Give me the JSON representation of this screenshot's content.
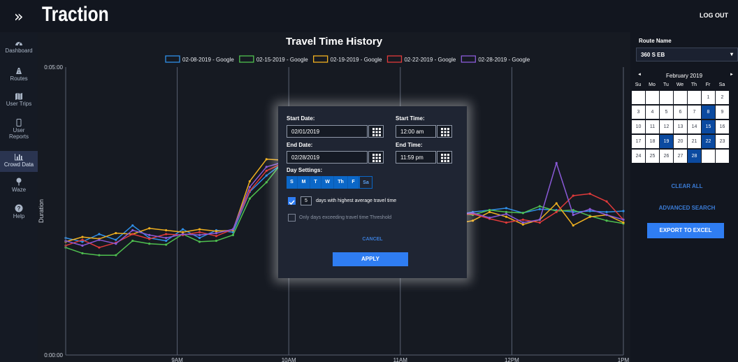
{
  "header": {
    "title": "Traction",
    "logo_icon": "double-chevron-right",
    "logout_label": "LOG OUT"
  },
  "sidebar": {
    "items": [
      {
        "label": "Dashboard",
        "icon": "dashboard-icon",
        "active": false
      },
      {
        "label": "Routes",
        "icon": "routes-icon",
        "active": false
      },
      {
        "label": "User Trips",
        "icon": "map-icon",
        "active": false
      },
      {
        "label": "User",
        "label2": "Reports",
        "icon": "phone-icon",
        "active": false
      },
      {
        "label": "Crowd Data",
        "icon": "bar-chart-icon",
        "active": true
      },
      {
        "label": "Waze",
        "icon": "pin-icon",
        "active": false
      },
      {
        "label": "Help",
        "icon": "help-icon",
        "active": false
      }
    ]
  },
  "chart_data": {
    "type": "line",
    "title": "Travel Time History",
    "xlabel": "",
    "ylabel": "Duration",
    "y_ticks": [
      "0:05:00",
      "0:00:00"
    ],
    "x_ticks": [
      "9AM",
      "10AM",
      "11AM",
      "12PM",
      "1PM"
    ],
    "x_range": [
      8.0,
      13.0
    ],
    "ylim": [
      0,
      300
    ],
    "grid": true,
    "legend_position": "top",
    "series": [
      {
        "name": "02-08-2019 - Google",
        "color": "#2f8fe8",
        "x": [
          8.0,
          8.15,
          8.3,
          8.45,
          8.6,
          8.75,
          8.9,
          9.05,
          9.2,
          9.35,
          9.5,
          9.65,
          9.8,
          9.95,
          10.6,
          10.75,
          10.9,
          11.05,
          11.2,
          11.35,
          11.5,
          11.65,
          11.8,
          11.95,
          12.1,
          12.25,
          12.4,
          12.55,
          12.7,
          12.85,
          13.0
        ],
        "y": [
          122,
          118,
          126,
          120,
          135,
          122,
          119,
          131,
          122,
          130,
          128,
          170,
          187,
          200,
          145,
          139,
          147,
          140,
          142,
          140,
          146,
          149,
          151,
          153,
          148,
          152,
          151,
          149,
          150,
          149,
          150
        ]
      },
      {
        "name": "02-15-2019 - Google",
        "color": "#4fc04f",
        "x": [
          8.0,
          8.15,
          8.3,
          8.45,
          8.6,
          8.75,
          8.9,
          9.05,
          9.2,
          9.35,
          9.5,
          9.65,
          9.8,
          9.95,
          10.6,
          10.75,
          10.9,
          11.05,
          11.2,
          11.35,
          11.5,
          11.65,
          11.8,
          11.95,
          12.1,
          12.25,
          12.4,
          12.55,
          12.7,
          12.85,
          13.0
        ],
        "y": [
          112,
          106,
          104,
          104,
          119,
          116,
          115,
          126,
          118,
          119,
          125,
          163,
          180,
          202,
          149,
          143,
          148,
          140,
          147,
          144,
          148,
          146,
          151,
          149,
          148,
          155,
          150,
          151,
          145,
          140,
          137
        ]
      },
      {
        "name": "02-19-2019 - Google",
        "color": "#f0b020",
        "x": [
          8.0,
          8.15,
          8.3,
          8.45,
          8.6,
          8.75,
          8.9,
          9.05,
          9.2,
          9.35,
          9.5,
          9.65,
          9.8,
          9.95,
          10.6,
          10.75,
          10.9,
          11.05,
          11.2,
          11.35,
          11.5,
          11.65,
          11.8,
          11.95,
          12.1,
          12.25,
          12.4,
          12.55,
          12.7,
          12.85,
          13.0
        ],
        "y": [
          118,
          123,
          121,
          127,
          126,
          132,
          130,
          128,
          131,
          129,
          130,
          181,
          204,
          203,
          149,
          146,
          145,
          139,
          138,
          141,
          137,
          140,
          149,
          144,
          136,
          141,
          158,
          135,
          144,
          146,
          138
        ]
      },
      {
        "name": "02-22-2019 - Google",
        "color": "#e03a3a",
        "x": [
          8.0,
          8.15,
          8.3,
          8.45,
          8.6,
          8.75,
          8.9,
          9.05,
          9.2,
          9.35,
          9.5,
          9.65,
          9.8,
          9.95,
          10.6,
          10.75,
          10.9,
          11.05,
          11.2,
          11.35,
          11.5,
          11.65,
          11.8,
          11.95,
          12.1,
          12.25,
          12.4,
          12.55,
          12.7,
          12.85,
          13.0
        ],
        "y": [
          114,
          120,
          112,
          117,
          126,
          121,
          126,
          125,
          128,
          124,
          131,
          171,
          192,
          200,
          147,
          147,
          141,
          143,
          147,
          142,
          146,
          147,
          142,
          138,
          141,
          138,
          149,
          166,
          168,
          160,
          141
        ]
      },
      {
        "name": "02-28-2019 - Google",
        "color": "#8a5ad8",
        "x": [
          8.0,
          8.15,
          8.3,
          8.45,
          8.6,
          8.75,
          8.9,
          9.05,
          9.2,
          9.35,
          9.5,
          9.65,
          9.8,
          9.95,
          10.6,
          10.75,
          10.9,
          11.05,
          11.2,
          11.35,
          11.5,
          11.65,
          11.8,
          11.95,
          12.1,
          12.25,
          12.4,
          12.55,
          12.7,
          12.85,
          13.0
        ],
        "y": [
          119,
          114,
          120,
          116,
          130,
          125,
          122,
          126,
          125,
          127,
          131,
          175,
          196,
          201,
          153,
          146,
          149,
          141,
          146,
          143,
          147,
          148,
          143,
          147,
          138,
          141,
          200,
          146,
          152,
          146,
          141
        ]
      }
    ]
  },
  "modal": {
    "start_date_label": "Start Date:",
    "start_date_value": "02/01/2019",
    "start_time_label": "Start Time:",
    "start_time_value": "12:00 am",
    "end_date_label": "End Date:",
    "end_date_value": "02/28/2019",
    "end_time_label": "End Time:",
    "end_time_value": "11:59 pm",
    "day_settings_label": "Day Settings:",
    "days": [
      {
        "label": "S",
        "selected": true
      },
      {
        "label": "M",
        "selected": true
      },
      {
        "label": "T",
        "selected": true
      },
      {
        "label": "W",
        "selected": true
      },
      {
        "label": "Th",
        "selected": true
      },
      {
        "label": "F",
        "selected": true
      },
      {
        "label": "Sa",
        "selected": false
      }
    ],
    "highest_days_value": "5",
    "highest_days_label": "days with highest average travel time",
    "threshold_label": "Only days exceeding travel time Threshold",
    "cancel_label": "CANCEL",
    "apply_label": "APPLY"
  },
  "right_panel": {
    "route_label": "Route Name",
    "route_value": "360 S EB",
    "calendar": {
      "prev_label": "◄",
      "next_label": "►",
      "month_label": "February 2019",
      "dows": [
        "Su",
        "Mo",
        "Tu",
        "We",
        "Th",
        "Fr",
        "Sa"
      ],
      "weeks": [
        [
          "",
          "",
          "",
          "",
          "",
          "1",
          "2"
        ],
        [
          "3",
          "4",
          "5",
          "6",
          "7",
          "8",
          "9"
        ],
        [
          "10",
          "11",
          "12",
          "13",
          "14",
          "15",
          "16"
        ],
        [
          "17",
          "18",
          "19",
          "20",
          "21",
          "22",
          "23"
        ],
        [
          "24",
          "25",
          "26",
          "27",
          "28",
          "",
          ""
        ]
      ],
      "selected": [
        "8",
        "15",
        "19",
        "22",
        "28"
      ]
    },
    "clear_all_label": "CLEAR ALL",
    "advanced_search_label": "ADVANCED SEARCH",
    "export_label": "EXPORT TO EXCEL"
  }
}
